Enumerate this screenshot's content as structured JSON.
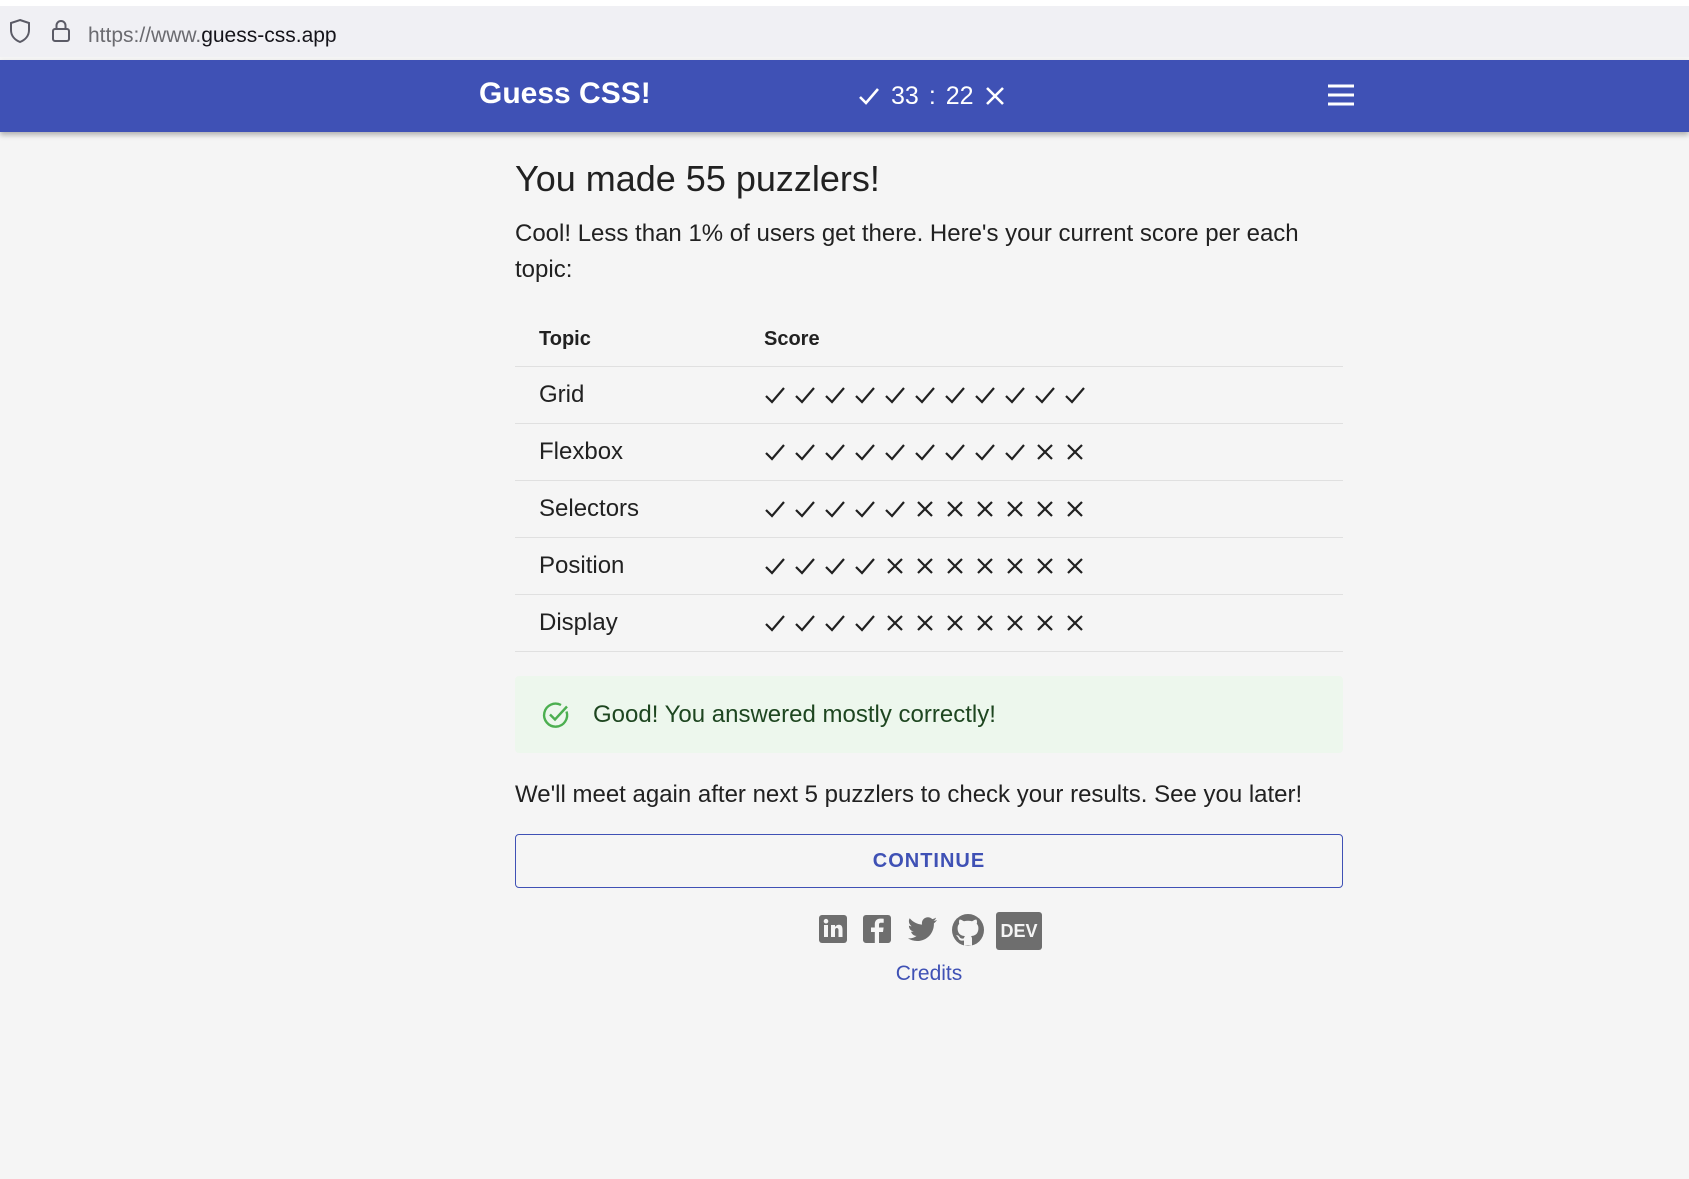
{
  "browser": {
    "url_scheme": "https://www.",
    "url_host": "guess-css.app"
  },
  "header": {
    "title": "Guess CSS!",
    "score_correct": "33",
    "score_separator": ":",
    "score_wrong": "22"
  },
  "main": {
    "headline": "You made 55 puzzlers!",
    "intro": "Cool! Less than 1% of users get there. Here's your current score per each topic:",
    "table": {
      "headers": [
        "Topic",
        "Score"
      ],
      "rows": [
        {
          "topic": "Grid",
          "correct": 11,
          "wrong": 0
        },
        {
          "topic": "Flexbox",
          "correct": 9,
          "wrong": 2
        },
        {
          "topic": "Selectors",
          "correct": 5,
          "wrong": 6
        },
        {
          "topic": "Position",
          "correct": 4,
          "wrong": 7
        },
        {
          "topic": "Display",
          "correct": 4,
          "wrong": 7
        }
      ]
    },
    "alert_text": "Good! You answered mostly correctly!",
    "followup": "We'll meet again after next 5 puzzlers to check your results. See you later!",
    "continue_label": "CONTINUE",
    "socials": [
      "linkedin-icon",
      "facebook-icon",
      "twitter-icon",
      "github-icon",
      "dev-icon"
    ],
    "dev_label": "DEV",
    "credits_label": "Credits"
  },
  "colors": {
    "primary": "#3f51b5",
    "background": "#f5f5f5",
    "success": "#4caf50",
    "success_bg": "#edf7ed"
  }
}
